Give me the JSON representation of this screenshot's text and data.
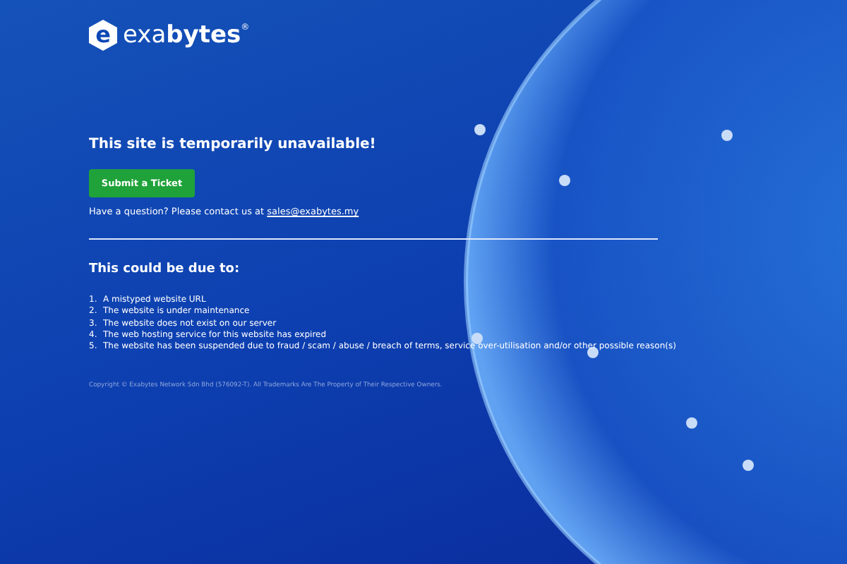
{
  "logo": {
    "mark": "e",
    "wordmark": "exa**bytes**$^{®}$"
  },
  "headline": "This site is temporarily unavailable!",
  "ticket_button": "Submit a Ticket",
  "contact": {
    "text": "Have a question? Please contact us at",
    "link": "sales@exabytes.my"
  },
  "reasons": {
    "title": "This could be due to:",
    "items": [
      {
        "number": "1.",
        "text": "A mistyped website URL"
      },
      {
        "number": "2.",
        "text": "The website is under maintenance"
      },
      {
        "number": "3.",
        "text": "The website does not exist on our server"
      },
      {
        "number": "4.",
        "text": "The web hosting service for this website has expired"
      },
      {
        "number": "5.",
        "text": "The website has been suspended due to fraud / scam / abuse / breach of terms, service over-utilisation and/or other possible reason(s)"
      }
    ]
  },
  "copyright": "Copyright © Exabytes Network Sdn Bhd (576092-T). All Trademarks Are The Property of Their Respective Owners."
}
